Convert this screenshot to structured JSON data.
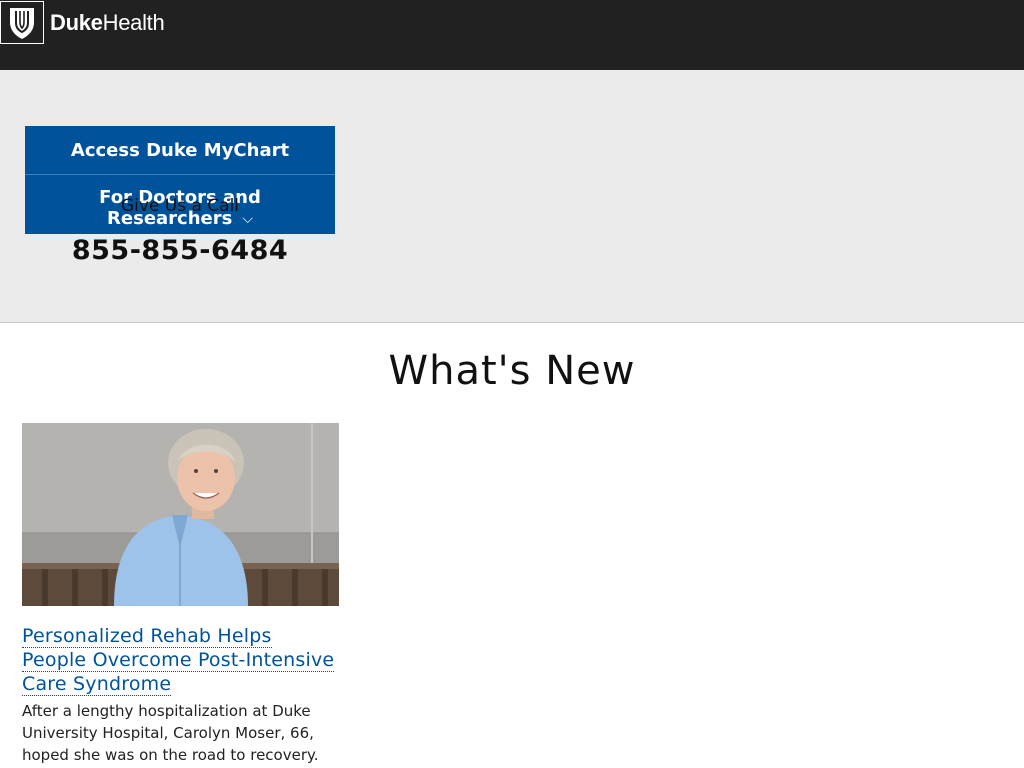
{
  "header": {
    "logo_bold": "Duke",
    "logo_light": "Health",
    "background_color": "#212121"
  },
  "band": {
    "mychart_button_label": "Access Duke MyChart",
    "doctors_button_label_line1": "For Doctors and",
    "doctors_button_label_line2": "Researchers",
    "call_label": "Give Us a Call",
    "phone_number": "855-855-6484",
    "button_color": "#00539b",
    "background_color": "#ebebeb"
  },
  "whats_new": {
    "title": "What's New",
    "articles": [
      {
        "title": "Personalized Rehab Helps People Overcome Post-Intensive Care Syndrome",
        "summary": "After a lengthy hospitalization at Duke University Hospital, Carolyn Moser, 66, hoped she was on the road to recovery.",
        "link_color": "#00539b"
      }
    ]
  }
}
